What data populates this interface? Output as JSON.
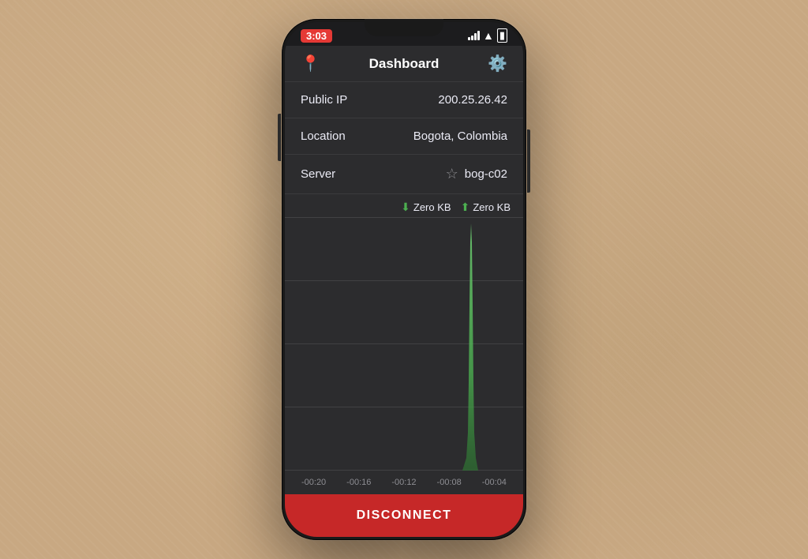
{
  "background": {
    "color": "#c8a882"
  },
  "phone": {
    "statusBar": {
      "time": "3:03",
      "timeColor": "#e53935"
    },
    "navBar": {
      "title": "Dashboard",
      "locationIconLabel": "location-pin-icon",
      "settingsIconLabel": "settings-icon"
    },
    "infoRows": [
      {
        "label": "Public IP",
        "value": "200.25.26.42"
      },
      {
        "label": "Location",
        "value": "Bogota, Colombia"
      },
      {
        "label": "Server",
        "value": "bog-c02"
      }
    ],
    "chartStats": {
      "download": {
        "label": "Zero KB",
        "arrowIcon": "arrow-down-icon"
      },
      "upload": {
        "label": "Zero KB",
        "arrowIcon": "arrow-up-icon"
      }
    },
    "chartTimeLabels": [
      "-00:20",
      "-00:16",
      "-00:12",
      "-00:08",
      "-00:04"
    ],
    "disconnectButton": {
      "label": "DISCONNECT",
      "bgColor": "#c62828"
    }
  }
}
